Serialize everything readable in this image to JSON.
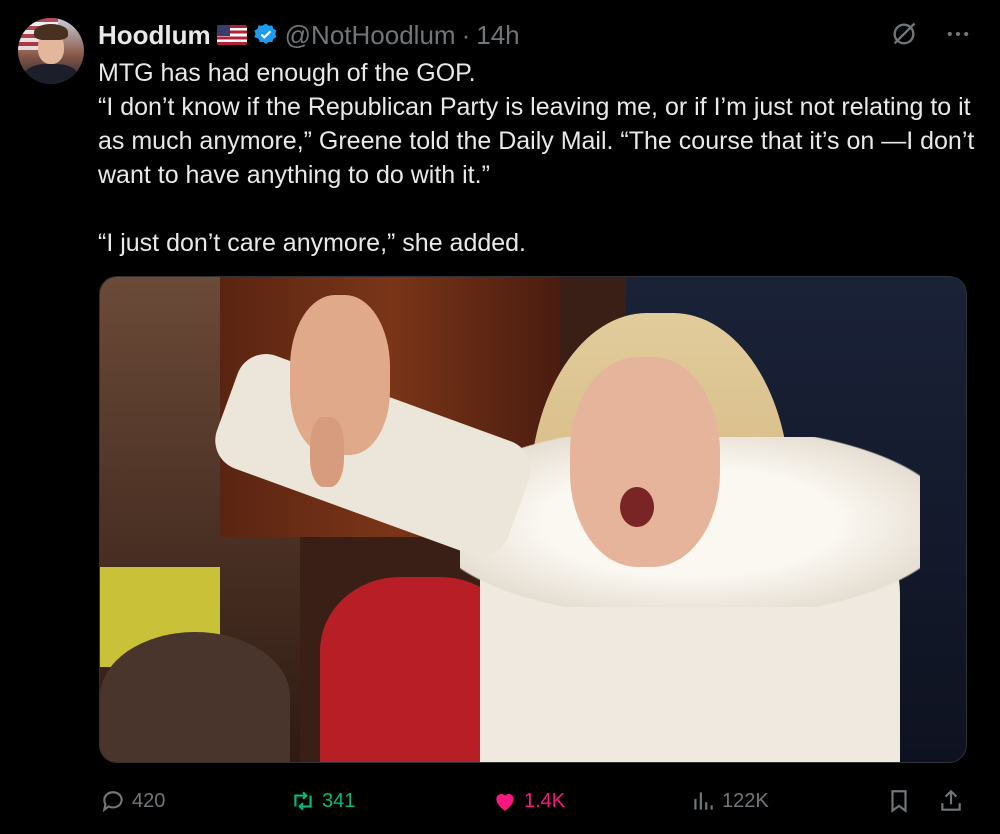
{
  "author": {
    "display_name": "Hoodlum",
    "handle": "@NotHoodlum",
    "separator": "·",
    "time": "14h"
  },
  "tweet": {
    "lines": [
      "MTG has had enough of the GOP.",
      "“I don’t know if the Republican Party is leaving me, or if I’m just not relating to it as much anymore,” Greene told the Daily Mail. “The course that it’s on —I don’t want to have anything to do with it.”",
      "“I just don’t care anymore,” she added."
    ]
  },
  "icons": {
    "grok": "grok-icon",
    "more": "more-icon",
    "reply": "reply-icon",
    "retweet": "retweet-icon",
    "like": "heart-icon",
    "views": "views-icon",
    "bookmark": "bookmark-icon",
    "share": "share-icon"
  },
  "metrics": {
    "replies": "420",
    "retweets": "341",
    "likes": "1.4K",
    "views": "122K"
  },
  "colors": {
    "retweet_active": "#00ba7c",
    "like_active": "#f91880",
    "verified": "#1d9bf0",
    "muted": "#71767b"
  }
}
